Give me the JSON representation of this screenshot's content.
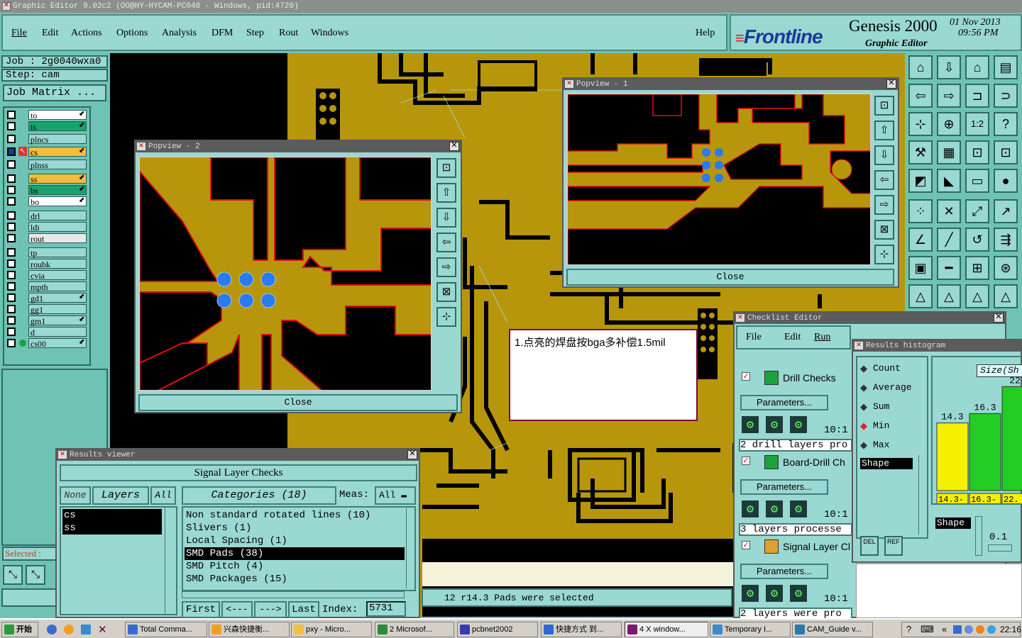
{
  "app": {
    "window_title": "Graphic Editor 9.02c2  (OO@HY-HYCAM-PC048 - Windows, pid:4720)"
  },
  "menu": {
    "items": [
      "File",
      "Edit",
      "Actions",
      "Options",
      "Analysis",
      "DFM",
      "Step",
      "Rout",
      "Windows"
    ],
    "help": "Help"
  },
  "brand": {
    "logo": "Frontline",
    "product": "Genesis 2000",
    "subtitle": "Graphic Editor",
    "date": "01 Nov 2013",
    "time": "09:56 PM"
  },
  "job": {
    "job_label": "Job : 2g0040wxa0",
    "step_label": "Step: cam",
    "matrix_button": "Job Matrix ..."
  },
  "layers": [
    {
      "name": "to",
      "color": "#ffffff",
      "icon": "⬋"
    },
    {
      "name": "ts",
      "color": "#1aa36b",
      "icon": "⬋"
    },
    {
      "name": "plncs",
      "color": "#9ad8d2",
      "icon": ""
    },
    {
      "name": "cs",
      "color": "#f6bd3c",
      "icon": "⬋"
    },
    {
      "name": "plnss",
      "color": "#9ad8d2",
      "icon": ""
    },
    {
      "name": "ss",
      "color": "#f6bd3c",
      "icon": "⬋"
    },
    {
      "name": "bs",
      "color": "#1aa36b",
      "icon": "⬋"
    },
    {
      "name": "bo",
      "color": "#ffffff",
      "icon": "⬋"
    },
    {
      "name": "drl",
      "color": "#9ad8d2",
      "icon": ""
    },
    {
      "name": "ldi",
      "color": "#9ad8d2",
      "icon": ""
    },
    {
      "name": "rout",
      "color": "#e8e8e8",
      "icon": ""
    },
    {
      "name": "tp",
      "color": "#9ad8d2",
      "icon": ""
    },
    {
      "name": "roubk",
      "color": "#9ad8d2",
      "icon": ""
    },
    {
      "name": "cvia",
      "color": "#9ad8d2",
      "icon": ""
    },
    {
      "name": "mpth",
      "color": "#9ad8d2",
      "icon": ""
    },
    {
      "name": "gd1",
      "color": "#9ad8d2",
      "icon": "⬋"
    },
    {
      "name": "gg1",
      "color": "#9ad8d2",
      "icon": ""
    },
    {
      "name": "gm1",
      "color": "#9ad8d2",
      "icon": "⬋"
    },
    {
      "name": "d",
      "color": "#9ad8d2",
      "icon": ""
    },
    {
      "name": "cs00",
      "color": "#9ad8d2",
      "icon": "⬋"
    }
  ],
  "selected_label": "Selected :",
  "popview1": {
    "title": "Popview - 1",
    "close": "Close"
  },
  "popview2": {
    "title": "Popview - 2",
    "close": "Close"
  },
  "note": {
    "text": "1.点亮的焊盘按bga多补偿1.5mil"
  },
  "results_viewer": {
    "title": "Results viewer",
    "header": "Signal Layer Checks",
    "none": "None",
    "layers": "Layers",
    "all": "All",
    "categories": "Categories (18)",
    "meas_label": "Meas:",
    "meas_value": "All",
    "layer_items": [
      "cs",
      "ss"
    ],
    "category_items": [
      "Non standard rotated lines (10)",
      "Slivers (1)",
      "Local Spacing (1)",
      "SMD Pads (38)",
      "SMD Pitch (4)",
      "SMD Packages (15)"
    ],
    "selected_category": "SMD Pads (38)",
    "nav": {
      "first": "First",
      "prev": "<---",
      "next": "--->",
      "last": "Last",
      "index_label": "Index:",
      "index_value": "5731"
    }
  },
  "status_message": "12 r14.3 Pads were selected",
  "checklist": {
    "title": "Checklist Editor",
    "menu": [
      "File",
      "Edit",
      "Run"
    ],
    "items": [
      {
        "name": "Drill Checks",
        "params": "Parameters...",
        "time": "10:1",
        "status": "2 drill layers pro"
      },
      {
        "name": "Board-Drill Ch",
        "params": "Parameters...",
        "time": "10:1",
        "status": "3 layers processe"
      },
      {
        "name": "Signal Layer Cl",
        "params": "Parameters...",
        "time": "10:1",
        "status": "2 layers were pro"
      }
    ]
  },
  "histogram": {
    "title": "Results histogram",
    "options": [
      "Count",
      "Average",
      "Sum",
      "Min",
      "Max"
    ],
    "selected_option": "Min",
    "shape_label": "Shape",
    "size_label": "Size(Sh",
    "del": "DEL",
    "ref": "REF",
    "shape_label2": "Shape",
    "scale_value": "0.1",
    "chart_data": {
      "type": "bar",
      "categories": [
        "14.3-14.4",
        "16.3-16.4",
        "22"
      ],
      "values": [
        14.3,
        16.3,
        22
      ],
      "value_labels": [
        "14.3",
        "16.3",
        "22."
      ],
      "category_labels_top": [
        "14.3-",
        "16.3-",
        "22."
      ],
      "category_labels_bottom": [
        "14.4",
        "16.4",
        "22"
      ],
      "colors": [
        "#f4f000",
        "#22cc22",
        "#22cc22"
      ]
    }
  },
  "taskbar": {
    "start": "开始",
    "tasks": [
      "Total Comma...",
      "兴森快捷衡...",
      "pxy - Micro...",
      "2 Microsof...",
      "pcbnet2002",
      "快捷方式 到...",
      "4 X window...",
      "Temporary I...",
      "CAM_Guide v..."
    ],
    "clock": "22:16"
  }
}
